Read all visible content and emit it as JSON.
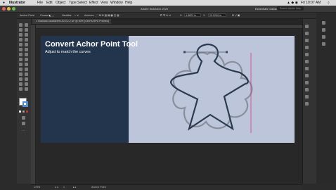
{
  "menubar": {
    "apple": "",
    "items": [
      "Illustrator",
      "File",
      "Edit",
      "Object",
      "Type",
      "Select",
      "Effect",
      "View",
      "Window",
      "Help"
    ],
    "clock": "Fri 10:07 AM"
  },
  "titlebar": {
    "title": "Adobe Illustrator 2020",
    "workspace": "Essentials Classic",
    "search_placeholder": "Search Adobe Help"
  },
  "controlbar": {
    "doc_label": "Anchor Point",
    "convert_label": "Convert:",
    "handles_label": "Handles:",
    "anchors_label": "Anchors:",
    "x_label": "X:",
    "x_value": "4.8823 in",
    "y_label": "Y:",
    "y_value": "20.0299 in"
  },
  "tab": {
    "label": "Illustrator-worksheet-20.3.2-2.ai* @ 50% (CMYK/GPU Preview)"
  },
  "artboard": {
    "heading": "Convert Achor Point Tool",
    "subheading": "Adjust to match the curves"
  },
  "statusbar": {
    "zoom": "175%",
    "page": "1",
    "tool": "Anchor Point"
  },
  "colors": {
    "dark_panel": "#22354d",
    "light_panel": "#bcc5d9",
    "star_stroke": "#2a3a4f",
    "flower_stroke": "#8a8f9c",
    "guide": "#d13b8a"
  }
}
